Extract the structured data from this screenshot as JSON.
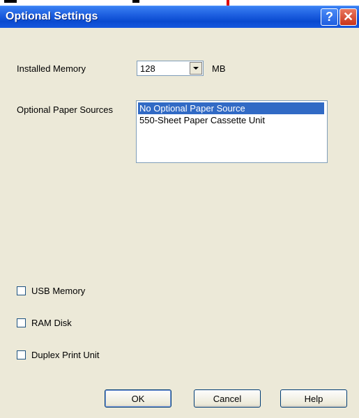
{
  "window": {
    "title": "Optional Settings",
    "help_button": "?",
    "close_button": "✕"
  },
  "memory": {
    "label": "Installed Memory",
    "value": "128",
    "unit": "MB"
  },
  "paper_sources": {
    "label": "Optional Paper Sources",
    "items": [
      {
        "label": "No Optional Paper Source",
        "selected": true
      },
      {
        "label": "550-Sheet Paper Cassette Unit",
        "selected": false
      }
    ]
  },
  "options": [
    {
      "label": "USB Memory",
      "checked": false
    },
    {
      "label": "RAM Disk",
      "checked": false
    },
    {
      "label": "Duplex Print Unit",
      "checked": false
    }
  ],
  "buttons": {
    "ok": "OK",
    "cancel": "Cancel",
    "help": "Help"
  },
  "colors": {
    "titlebar": "#0a4ad0",
    "dialog_bg": "#ece9d8",
    "selection": "#316ac5"
  }
}
